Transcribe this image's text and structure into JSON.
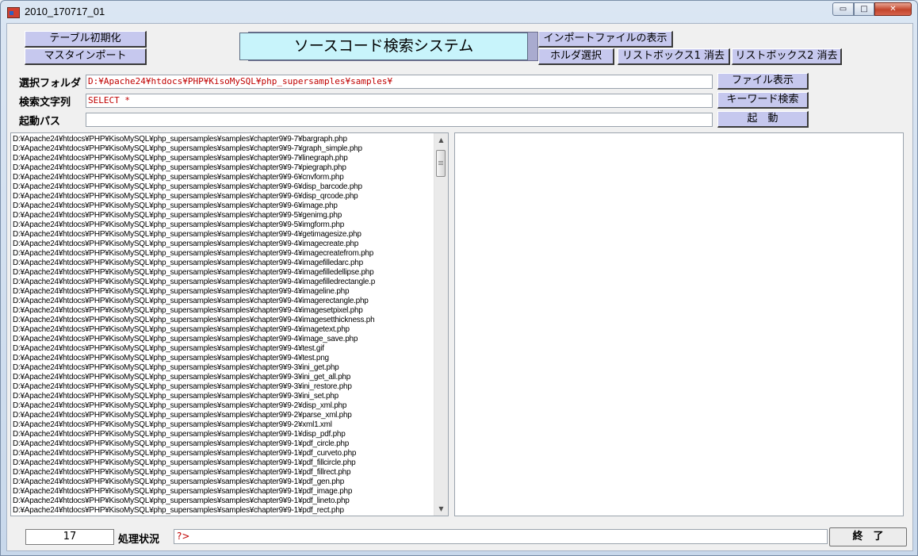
{
  "window": {
    "title": "2010_170717_01",
    "minimize_glyph": "▭",
    "maximize_glyph": "□",
    "close_glyph": "✕"
  },
  "buttons": {
    "table_init": "テーブル初期化",
    "master_import": "マスタインポート",
    "show_import_file": "インポートファイルの表示",
    "folder_select": "ホルダ選択",
    "clear_listbox1": "リストボックス1 消去",
    "clear_listbox2": "リストボックス2 消去",
    "show_file": "ファイル表示",
    "keyword_search": "キーワード検索",
    "launch": "起　動",
    "end": "終　了"
  },
  "heading": "ソースコード検索システム",
  "fields": {
    "folder_label": "選択フォルダ",
    "folder_value": "D:¥Apache24¥htdocs¥PHP¥KisoMySQL¥php_supersamples¥samples¥",
    "search_label": "検索文字列",
    "search_value": "SELECT *",
    "path_label": "起動パス",
    "path_value": ""
  },
  "listbox1": {
    "items": [
      "D:¥Apache24¥htdocs¥PHP¥KisoMySQL¥php_supersamples¥samples¥chapter9¥9-7¥bargraph.php",
      "D:¥Apache24¥htdocs¥PHP¥KisoMySQL¥php_supersamples¥samples¥chapter9¥9-7¥graph_simple.php",
      "D:¥Apache24¥htdocs¥PHP¥KisoMySQL¥php_supersamples¥samples¥chapter9¥9-7¥linegraph.php",
      "D:¥Apache24¥htdocs¥PHP¥KisoMySQL¥php_supersamples¥samples¥chapter9¥9-7¥piegraph.php",
      "D:¥Apache24¥htdocs¥PHP¥KisoMySQL¥php_supersamples¥samples¥chapter9¥9-6¥cnvform.php",
      "D:¥Apache24¥htdocs¥PHP¥KisoMySQL¥php_supersamples¥samples¥chapter9¥9-6¥disp_barcode.php",
      "D:¥Apache24¥htdocs¥PHP¥KisoMySQL¥php_supersamples¥samples¥chapter9¥9-6¥disp_qrcode.php",
      "D:¥Apache24¥htdocs¥PHP¥KisoMySQL¥php_supersamples¥samples¥chapter9¥9-6¥image.php",
      "D:¥Apache24¥htdocs¥PHP¥KisoMySQL¥php_supersamples¥samples¥chapter9¥9-5¥genimg.php",
      "D:¥Apache24¥htdocs¥PHP¥KisoMySQL¥php_supersamples¥samples¥chapter9¥9-5¥imgform.php",
      "D:¥Apache24¥htdocs¥PHP¥KisoMySQL¥php_supersamples¥samples¥chapter9¥9-4¥getimagesize.php",
      "D:¥Apache24¥htdocs¥PHP¥KisoMySQL¥php_supersamples¥samples¥chapter9¥9-4¥imagecreate.php",
      "D:¥Apache24¥htdocs¥PHP¥KisoMySQL¥php_supersamples¥samples¥chapter9¥9-4¥imagecreatefrom.php",
      "D:¥Apache24¥htdocs¥PHP¥KisoMySQL¥php_supersamples¥samples¥chapter9¥9-4¥imagefilledarc.php",
      "D:¥Apache24¥htdocs¥PHP¥KisoMySQL¥php_supersamples¥samples¥chapter9¥9-4¥imagefilledellipse.php",
      "D:¥Apache24¥htdocs¥PHP¥KisoMySQL¥php_supersamples¥samples¥chapter9¥9-4¥imagefilledrectangle.p",
      "D:¥Apache24¥htdocs¥PHP¥KisoMySQL¥php_supersamples¥samples¥chapter9¥9-4¥imageline.php",
      "D:¥Apache24¥htdocs¥PHP¥KisoMySQL¥php_supersamples¥samples¥chapter9¥9-4¥imagerectangle.php",
      "D:¥Apache24¥htdocs¥PHP¥KisoMySQL¥php_supersamples¥samples¥chapter9¥9-4¥imagesetpixel.php",
      "D:¥Apache24¥htdocs¥PHP¥KisoMySQL¥php_supersamples¥samples¥chapter9¥9-4¥imagesetthickness.ph",
      "D:¥Apache24¥htdocs¥PHP¥KisoMySQL¥php_supersamples¥samples¥chapter9¥9-4¥imagetext.php",
      "D:¥Apache24¥htdocs¥PHP¥KisoMySQL¥php_supersamples¥samples¥chapter9¥9-4¥image_save.php",
      "D:¥Apache24¥htdocs¥PHP¥KisoMySQL¥php_supersamples¥samples¥chapter9¥9-4¥test.gif",
      "D:¥Apache24¥htdocs¥PHP¥KisoMySQL¥php_supersamples¥samples¥chapter9¥9-4¥test.png",
      "D:¥Apache24¥htdocs¥PHP¥KisoMySQL¥php_supersamples¥samples¥chapter9¥9-3¥ini_get.php",
      "D:¥Apache24¥htdocs¥PHP¥KisoMySQL¥php_supersamples¥samples¥chapter9¥9-3¥ini_get_all.php",
      "D:¥Apache24¥htdocs¥PHP¥KisoMySQL¥php_supersamples¥samples¥chapter9¥9-3¥ini_restore.php",
      "D:¥Apache24¥htdocs¥PHP¥KisoMySQL¥php_supersamples¥samples¥chapter9¥9-3¥ini_set.php",
      "D:¥Apache24¥htdocs¥PHP¥KisoMySQL¥php_supersamples¥samples¥chapter9¥9-2¥disp_xml.php",
      "D:¥Apache24¥htdocs¥PHP¥KisoMySQL¥php_supersamples¥samples¥chapter9¥9-2¥parse_xml.php",
      "D:¥Apache24¥htdocs¥PHP¥KisoMySQL¥php_supersamples¥samples¥chapter9¥9-2¥xml1.xml",
      "D:¥Apache24¥htdocs¥PHP¥KisoMySQL¥php_supersamples¥samples¥chapter9¥9-1¥disp_pdf.php",
      "D:¥Apache24¥htdocs¥PHP¥KisoMySQL¥php_supersamples¥samples¥chapter9¥9-1¥pdf_circle.php",
      "D:¥Apache24¥htdocs¥PHP¥KisoMySQL¥php_supersamples¥samples¥chapter9¥9-1¥pdf_curveto.php",
      "D:¥Apache24¥htdocs¥PHP¥KisoMySQL¥php_supersamples¥samples¥chapter9¥9-1¥pdf_fillcircle.php",
      "D:¥Apache24¥htdocs¥PHP¥KisoMySQL¥php_supersamples¥samples¥chapter9¥9-1¥pdf_fillrect.php",
      "D:¥Apache24¥htdocs¥PHP¥KisoMySQL¥php_supersamples¥samples¥chapter9¥9-1¥pdf_gen.php",
      "D:¥Apache24¥htdocs¥PHP¥KisoMySQL¥php_supersamples¥samples¥chapter9¥9-1¥pdf_image.php",
      "D:¥Apache24¥htdocs¥PHP¥KisoMySQL¥php_supersamples¥samples¥chapter9¥9-1¥pdf_lineto.php",
      "D:¥Apache24¥htdocs¥PHP¥KisoMySQL¥php_supersamples¥samples¥chapter9¥9-1¥pdf_rect.php"
    ],
    "scroll_up_glyph": "▲",
    "scroll_down_glyph": "▼"
  },
  "listbox2": {
    "items": []
  },
  "status": {
    "count": "17",
    "label": "処理状況",
    "value": "?>"
  }
}
